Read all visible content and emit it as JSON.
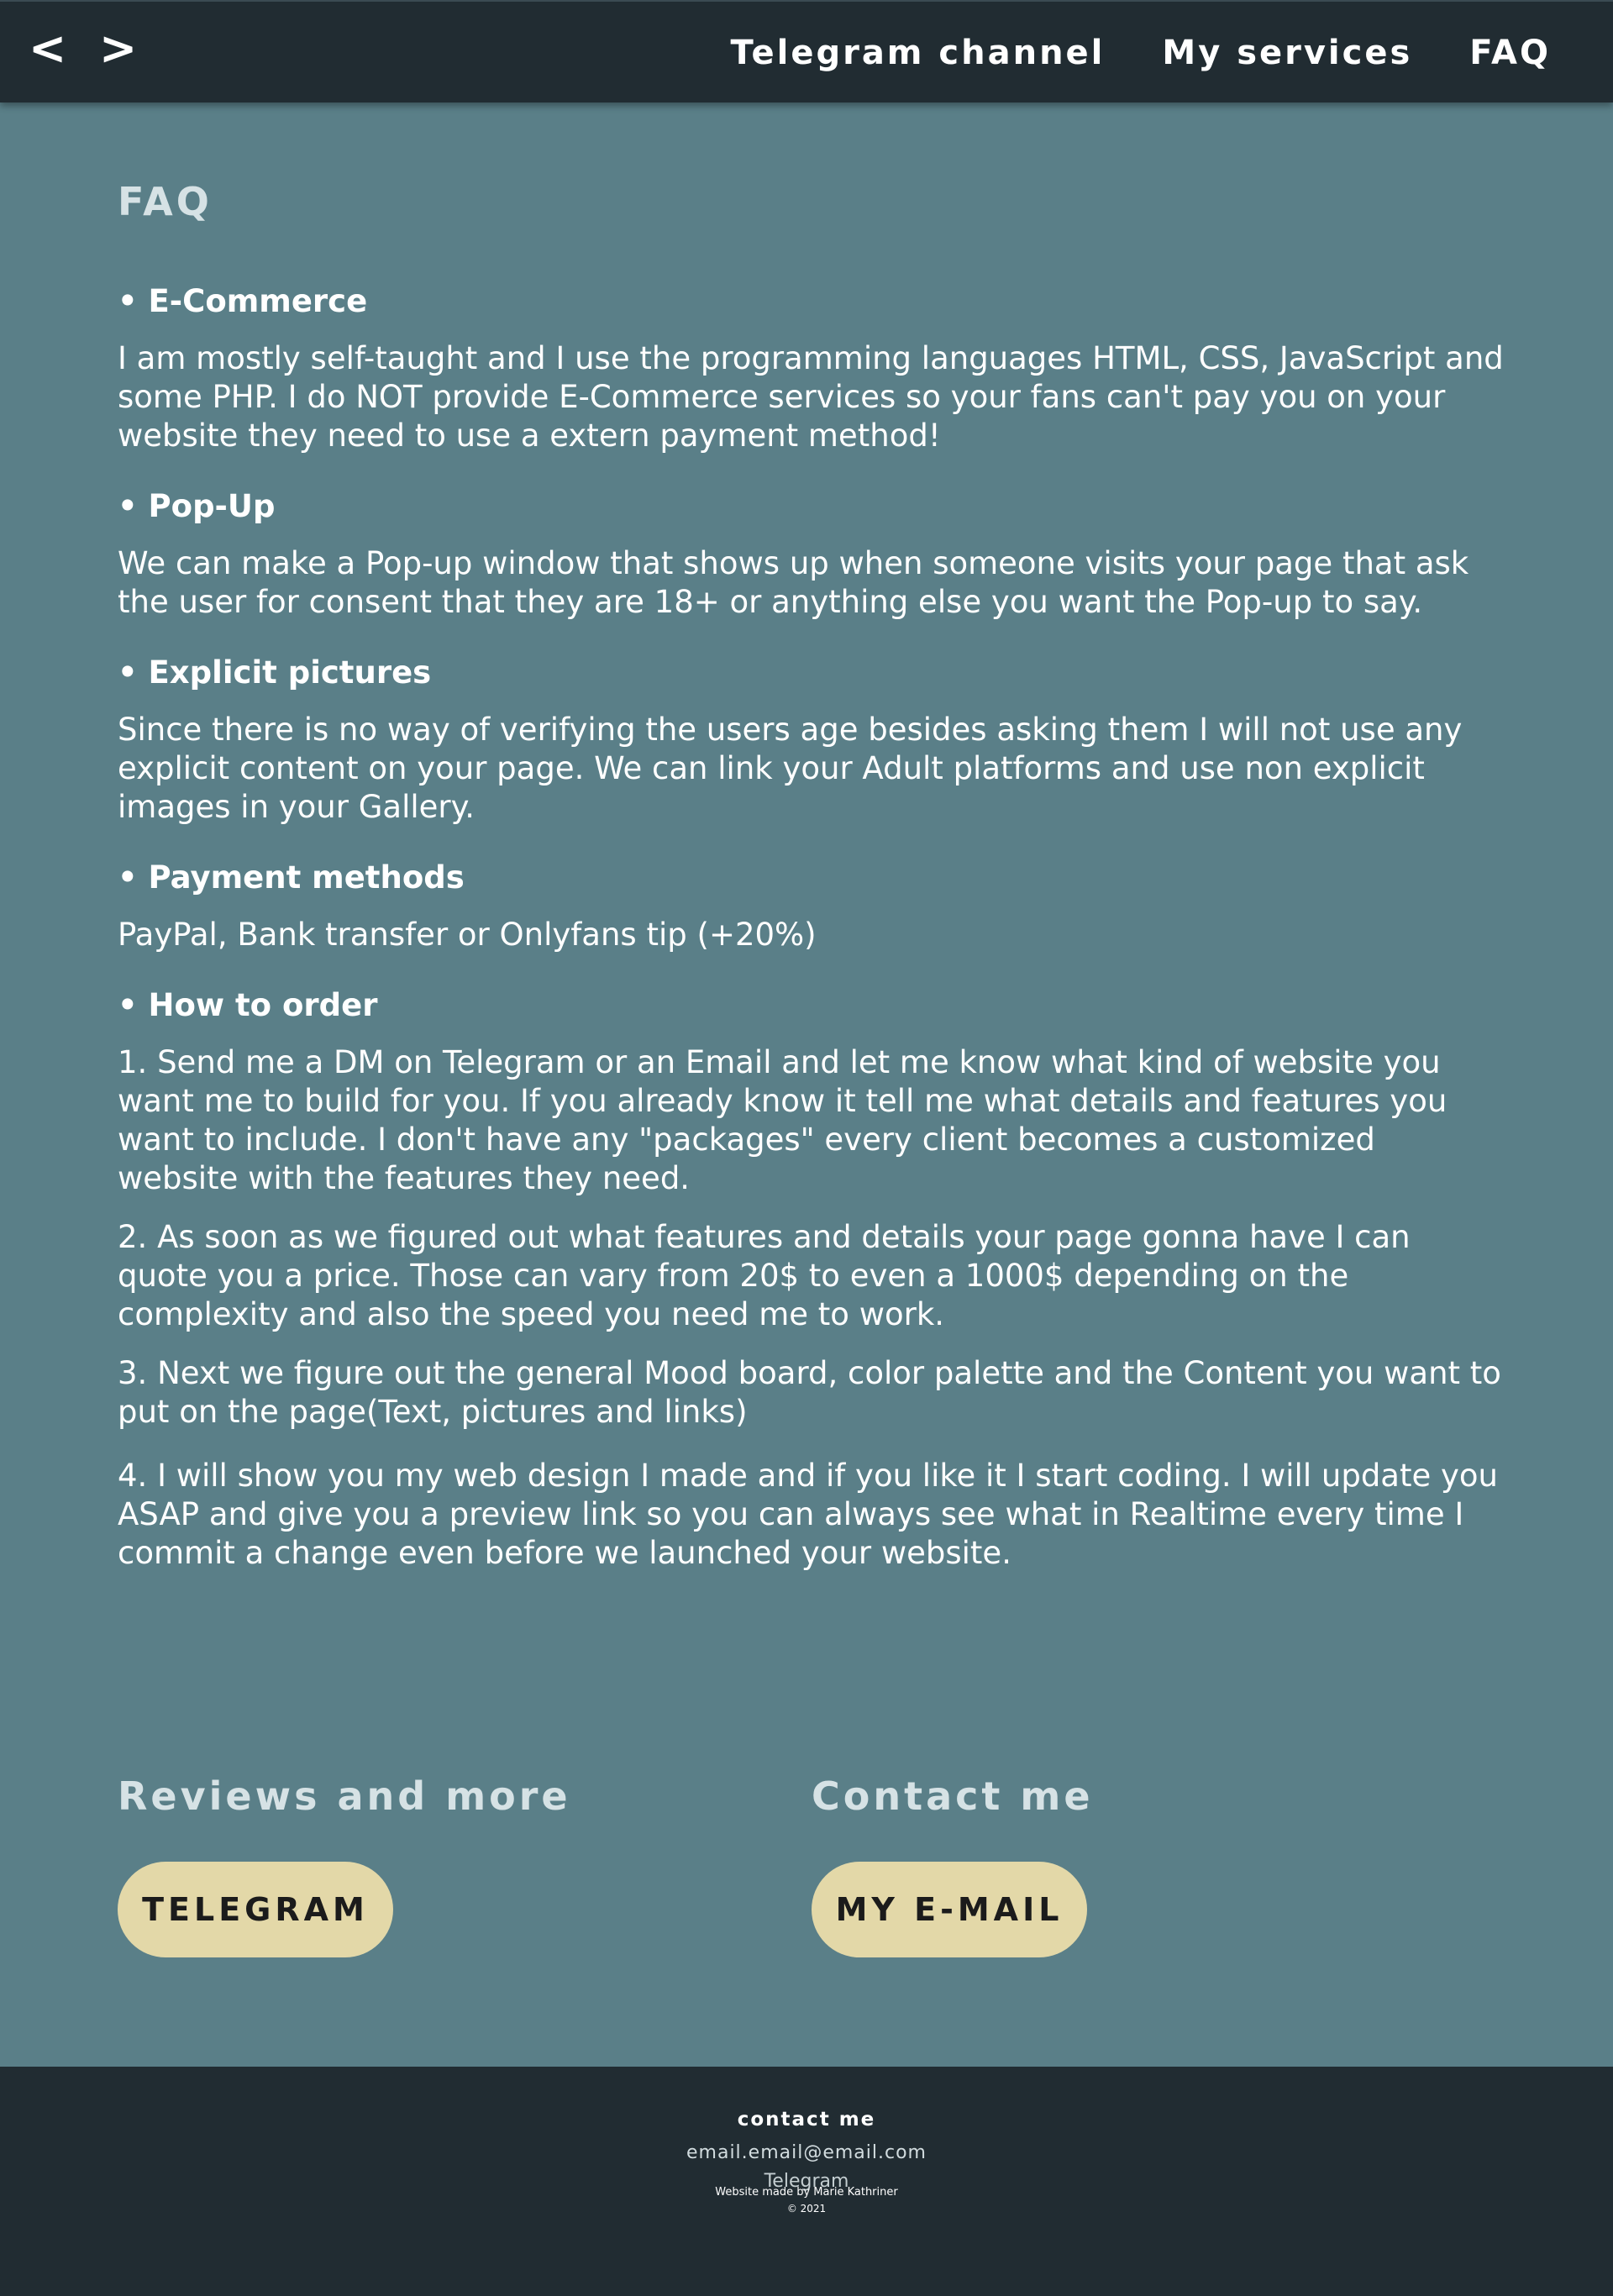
{
  "header": {
    "logo": "< >",
    "nav": [
      "Telegram channel",
      "My services",
      "FAQ"
    ]
  },
  "faq": {
    "title": "FAQ",
    "items": [
      {
        "q": "• E-Commerce",
        "a": [
          "I am mostly self-taught and I use the programming languages HTML, CSS, JavaScript and some PHP. I do NOT provide E-Commerce services so your fans can't pay you on your website they need to use a extern payment method!"
        ]
      },
      {
        "q": "• Pop-Up",
        "a": [
          "We can make a Pop-up window that shows up when someone visits your page that ask the user for consent that they are 18+ or anything else you want the Pop-up to say."
        ]
      },
      {
        "q": "• Explicit pictures",
        "a": [
          "Since there is no way of verifying the users age besides asking them I will not use any explicit content on your page. We can link your Adult platforms and use non explicit images in your Gallery."
        ]
      },
      {
        "q": "• Payment methods",
        "a": [
          "PayPal, Bank transfer or Onlyfans tip (+20%)"
        ]
      },
      {
        "q": "• How to order",
        "a": [
          "1. Send me a DM on Telegram or an Email and let me know what kind of website you want me to build for you. If you already know it tell me what details and features you want to include. I don't have any \"packages\" every client becomes a customized website with the features they need.",
          "2. As soon as we figured out what features and details your page gonna have I can quote you a price. Those can vary from 20$ to even a 1000$ depending on the complexity and also the speed you need me to work.",
          "3. Next we figure out the general Mood board, color palette and the Content you want to put on the page(Text, pictures and links)",
          "4. I will show you my web design I made and if you like it I start coding. I will update you ASAP and give you a preview link so you can always see what in Realtime every time I commit a change even before we launched your website."
        ]
      }
    ]
  },
  "cta": {
    "left_title": "Reviews and more",
    "left_button": "TELEGRAM",
    "right_title": "Contact me",
    "right_button": "MY E-MAIL"
  },
  "footer": {
    "heading": "contact me",
    "email": "email.email@email.com",
    "telegram": "Telegram",
    "made_by": "Website made by Marie Kathriner",
    "copyright": "© 2021"
  },
  "colors": {
    "page_bg": "#5a7f88",
    "bar_bg": "#212c32",
    "heading": "#d6e2e5",
    "button_bg": "#e3d8a8"
  }
}
